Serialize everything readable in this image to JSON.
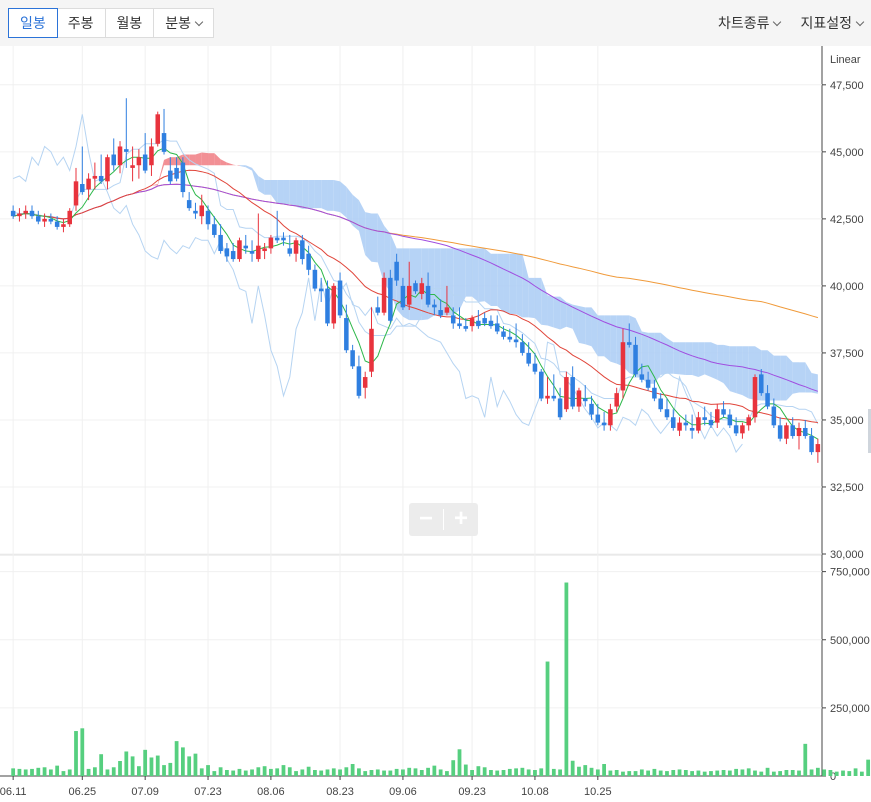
{
  "toolbar": {
    "tabs": [
      {
        "label": "일봉",
        "active": true
      },
      {
        "label": "주봉",
        "active": false
      },
      {
        "label": "월봉",
        "active": false
      },
      {
        "label": "분봉",
        "active": false,
        "dropdown": true
      }
    ],
    "menus": [
      {
        "label": "차트종류"
      },
      {
        "label": "지표설정"
      }
    ]
  },
  "zoom": {
    "minus": "−",
    "plus": "+"
  },
  "colors": {
    "up": "#e8333d",
    "down": "#2f7fe0",
    "volume": "#56cf7f",
    "ma5": "#2db84a",
    "ma20": "#e0453a",
    "ma60": "#a04ee0",
    "ma120": "#f09a3a",
    "cloud_bull": "#f07c83",
    "cloud_bear": "#a9cbf5",
    "band": "#b6d4f2"
  },
  "chart_data": {
    "type": "candlestick",
    "scale_label": "Linear",
    "price_axis": {
      "ticks": [
        "47,500",
        "45,000",
        "42,500",
        "40,000",
        "37,500",
        "35,000",
        "32,500",
        "30,000"
      ],
      "range": [
        30000,
        48500
      ]
    },
    "volume_axis": {
      "ticks": [
        "750,000",
        "500,000",
        "250,000",
        "0"
      ],
      "range": [
        0,
        800000
      ]
    },
    "x_ticks": [
      "06.11",
      "06.25",
      "07.09",
      "07.23",
      "08.06",
      "08.23",
      "09.06",
      "09.23",
      "10.08",
      "10.25"
    ],
    "x_tick_index": [
      0,
      11,
      21,
      31,
      41,
      52,
      62,
      73,
      83,
      93
    ],
    "candles": [
      [
        42800,
        43000,
        42500,
        42600
      ],
      [
        42600,
        42900,
        42400,
        42700
      ],
      [
        42700,
        43000,
        42500,
        42800
      ],
      [
        42800,
        43000,
        42500,
        42600
      ],
      [
        42600,
        42800,
        42300,
        42400
      ],
      [
        42400,
        42700,
        42200,
        42500
      ],
      [
        42500,
        42700,
        42300,
        42400
      ],
      [
        42400,
        42600,
        42100,
        42200
      ],
      [
        42200,
        42500,
        42000,
        42300
      ],
      [
        42300,
        42900,
        42200,
        42800
      ],
      [
        43000,
        44400,
        42800,
        43900
      ],
      [
        43800,
        45200,
        43400,
        43500
      ],
      [
        43600,
        44200,
        43200,
        44000
      ],
      [
        44000,
        44600,
        43600,
        44100
      ],
      [
        44100,
        44900,
        43800,
        43900
      ],
      [
        43900,
        44900,
        43600,
        44800
      ],
      [
        44900,
        45500,
        44300,
        44500
      ],
      [
        44500,
        45400,
        44200,
        45200
      ],
      [
        45100,
        47000,
        44400,
        45000
      ],
      [
        44400,
        45200,
        43900,
        44500
      ],
      [
        44500,
        45100,
        44000,
        44800
      ],
      [
        44900,
        45700,
        44200,
        44300
      ],
      [
        44500,
        45500,
        44100,
        45200
      ],
      [
        45300,
        46500,
        45200,
        46400
      ],
      [
        45700,
        46600,
        44900,
        45000
      ],
      [
        44300,
        44800,
        43800,
        43900
      ],
      [
        44400,
        44800,
        43900,
        44000
      ],
      [
        44600,
        44800,
        43300,
        43500
      ],
      [
        43200,
        43500,
        42800,
        42900
      ],
      [
        42800,
        43100,
        42500,
        42700
      ],
      [
        42600,
        43400,
        42300,
        43000
      ],
      [
        42800,
        43000,
        42100,
        42300
      ],
      [
        42300,
        42600,
        41800,
        41900
      ],
      [
        41900,
        42300,
        41200,
        41300
      ],
      [
        41400,
        41600,
        40900,
        41100
      ],
      [
        41300,
        41600,
        40900,
        41000
      ],
      [
        41000,
        41800,
        40900,
        41700
      ],
      [
        41500,
        41900,
        41200,
        41400
      ],
      [
        41300,
        41700,
        40900,
        41200
      ],
      [
        41000,
        42700,
        40900,
        41500
      ],
      [
        41300,
        41600,
        41000,
        41400
      ],
      [
        41400,
        41900,
        41200,
        41800
      ],
      [
        41800,
        42800,
        41600,
        41700
      ],
      [
        41800,
        42000,
        41500,
        41700
      ],
      [
        41400,
        41900,
        41100,
        41200
      ],
      [
        41200,
        41800,
        40900,
        41700
      ],
      [
        41700,
        41900,
        40800,
        41000
      ],
      [
        41200,
        41500,
        40400,
        40600
      ],
      [
        40600,
        40800,
        39800,
        39900
      ],
      [
        39900,
        40300,
        39400,
        39800
      ],
      [
        39900,
        40200,
        38500,
        38600
      ],
      [
        38600,
        40100,
        38400,
        40000
      ],
      [
        40200,
        40500,
        38800,
        38900
      ],
      [
        38800,
        39300,
        37500,
        37600
      ],
      [
        37600,
        37800,
        36900,
        37000
      ],
      [
        37000,
        37400,
        35800,
        35900
      ],
      [
        36200,
        36800,
        35800,
        36600
      ],
      [
        36800,
        39200,
        36600,
        38400
      ],
      [
        39200,
        39600,
        38900,
        39000
      ],
      [
        39000,
        40500,
        38900,
        40300
      ],
      [
        40300,
        40600,
        38600,
        38700
      ],
      [
        40900,
        41200,
        40000,
        40200
      ],
      [
        40000,
        40300,
        39100,
        39200
      ],
      [
        39300,
        40900,
        39100,
        40000
      ],
      [
        40100,
        40200,
        39700,
        39800
      ],
      [
        39700,
        40300,
        39500,
        40100
      ],
      [
        40000,
        40500,
        39200,
        39300
      ],
      [
        39300,
        39500,
        38900,
        39200
      ],
      [
        39100,
        39500,
        38800,
        38900
      ],
      [
        39000,
        40000,
        38900,
        39200
      ],
      [
        38900,
        39200,
        38400,
        38600
      ],
      [
        38600,
        39200,
        38400,
        38500
      ],
      [
        38500,
        38800,
        38300,
        38400
      ],
      [
        38500,
        38900,
        38300,
        38800
      ],
      [
        38700,
        39100,
        38400,
        38500
      ],
      [
        38800,
        39000,
        38500,
        38600
      ],
      [
        38700,
        38900,
        38400,
        38500
      ],
      [
        38600,
        38900,
        38200,
        38300
      ],
      [
        38300,
        38500,
        38000,
        38100
      ],
      [
        38100,
        38400,
        37900,
        38000
      ],
      [
        38000,
        38600,
        37700,
        37900
      ],
      [
        37900,
        38200,
        37400,
        37500
      ],
      [
        37500,
        37900,
        37000,
        37100
      ],
      [
        37100,
        37500,
        36700,
        36800
      ],
      [
        36800,
        36900,
        35700,
        35800
      ],
      [
        35800,
        36600,
        35600,
        35900
      ],
      [
        35900,
        36700,
        35700,
        35800
      ],
      [
        35800,
        36200,
        35000,
        35100
      ],
      [
        35400,
        36800,
        35300,
        36600
      ],
      [
        36600,
        37000,
        35400,
        35500
      ],
      [
        35500,
        36200,
        35300,
        36100
      ],
      [
        35800,
        36300,
        35500,
        35700
      ],
      [
        35600,
        35900,
        35000,
        35200
      ],
      [
        35200,
        35600,
        34800,
        34900
      ],
      [
        34900,
        35300,
        34600,
        34800
      ],
      [
        34800,
        35600,
        34600,
        35400
      ],
      [
        35500,
        36200,
        35300,
        36000
      ],
      [
        36100,
        38400,
        35800,
        37900
      ],
      [
        37900,
        38600,
        37700,
        37800
      ],
      [
        37800,
        38100,
        36600,
        36700
      ],
      [
        36700,
        37100,
        36400,
        36500
      ],
      [
        36500,
        36800,
        36100,
        36200
      ],
      [
        36200,
        36500,
        35700,
        35800
      ],
      [
        35800,
        36000,
        35300,
        35400
      ],
      [
        35400,
        35800,
        35000,
        35100
      ],
      [
        35100,
        35400,
        34600,
        34700
      ],
      [
        34600,
        35100,
        34400,
        34900
      ],
      [
        34900,
        35200,
        34600,
        34800
      ],
      [
        34700,
        35200,
        34300,
        34600
      ],
      [
        34600,
        35300,
        34500,
        35100
      ],
      [
        35100,
        35500,
        34800,
        35000
      ],
      [
        35000,
        35300,
        34700,
        34800
      ],
      [
        34900,
        35600,
        34700,
        35400
      ],
      [
        35400,
        35700,
        35100,
        35200
      ],
      [
        35200,
        35400,
        34700,
        34800
      ],
      [
        34800,
        35100,
        34400,
        34500
      ],
      [
        34500,
        34900,
        34300,
        34800
      ],
      [
        34800,
        35200,
        34600,
        35100
      ],
      [
        35100,
        36700,
        34900,
        36600
      ],
      [
        36700,
        36900,
        35900,
        36000
      ],
      [
        36000,
        36300,
        35400,
        35500
      ],
      [
        35500,
        35800,
        34700,
        34800
      ],
      [
        34800,
        35100,
        34200,
        34300
      ],
      [
        34300,
        34900,
        34100,
        34800
      ],
      [
        34800,
        35100,
        34300,
        34400
      ],
      [
        34400,
        34900,
        33900,
        34700
      ],
      [
        34700,
        35000,
        34300,
        34400
      ],
      [
        34400,
        34700,
        33700,
        33800
      ],
      [
        33800,
        34300,
        33400,
        34100
      ]
    ],
    "volumes": [
      28000,
      26000,
      24000,
      26000,
      30000,
      32000,
      24000,
      38000,
      18000,
      24000,
      165000,
      175000,
      26000,
      32000,
      80000,
      24000,
      32000,
      55000,
      90000,
      72000,
      36000,
      96000,
      68000,
      75000,
      40000,
      48000,
      128000,
      105000,
      72000,
      82000,
      28000,
      40000,
      18000,
      32000,
      22000,
      20000,
      26000,
      20000,
      24000,
      32000,
      36000,
      26000,
      28000,
      40000,
      32000,
      18000,
      24000,
      34000,
      22000,
      20000,
      24000,
      28000,
      24000,
      32000,
      44000,
      28000,
      18000,
      22000,
      24000,
      20000,
      20000,
      26000,
      24000,
      30000,
      28000,
      22000,
      30000,
      38000,
      24000,
      18000,
      58000,
      98000,
      42000,
      22000,
      36000,
      32000,
      22000,
      20000,
      22000,
      26000,
      28000,
      30000,
      24000,
      22000,
      28000,
      420000,
      26000,
      24000,
      710000,
      56000,
      34000,
      40000,
      30000,
      24000,
      44000,
      20000,
      22000,
      16000,
      18000,
      18000,
      24000,
      20000,
      26000,
      20000,
      18000,
      22000,
      24000,
      22000,
      18000,
      20000,
      16000,
      18000,
      20000,
      22000,
      20000,
      26000,
      24000,
      28000,
      20000,
      16000,
      30000,
      16000,
      18000,
      22000,
      22000,
      20000,
      118000,
      24000,
      30000,
      24000,
      22000,
      16000,
      20000,
      18000,
      28000,
      16000,
      60000,
      18000,
      16000,
      16000,
      28000,
      18000,
      20000
    ]
  }
}
